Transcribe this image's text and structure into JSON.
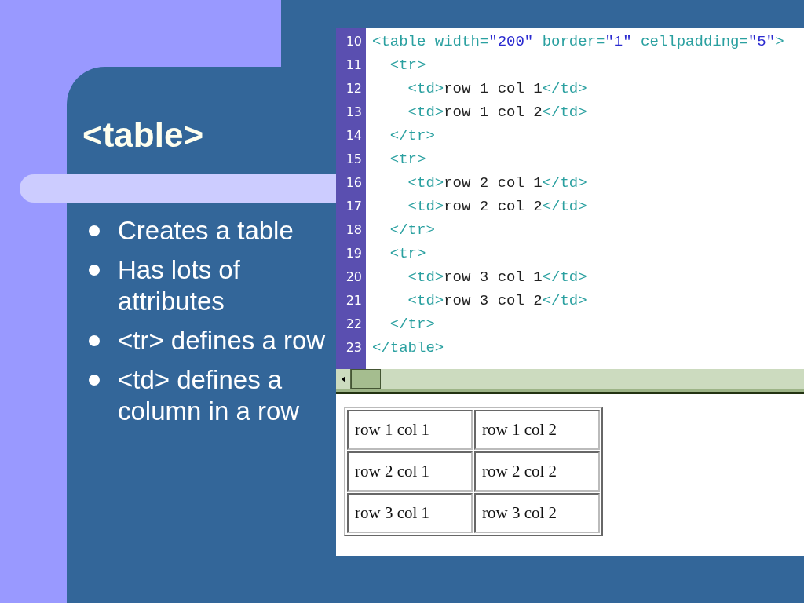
{
  "slide": {
    "title": "<table>",
    "bullets": [
      "Creates a table",
      "Has lots of attributes",
      "<tr> defines a row",
      "<td> defines a column in a row"
    ]
  },
  "editor": {
    "lines": [
      {
        "number": "10",
        "tokens": [
          {
            "kind": "tag",
            "text": "<table width="
          },
          {
            "kind": "value",
            "text": "\"200\""
          },
          {
            "kind": "tag",
            "text": " border="
          },
          {
            "kind": "value",
            "text": "\"1\""
          },
          {
            "kind": "tag",
            "text": " cellpadding="
          },
          {
            "kind": "value",
            "text": "\"5\""
          },
          {
            "kind": "tag",
            "text": ">"
          }
        ]
      },
      {
        "number": "11",
        "tokens": [
          {
            "kind": "tag",
            "text": "  <tr>"
          }
        ]
      },
      {
        "number": "12",
        "tokens": [
          {
            "kind": "tag",
            "text": "    <td>"
          },
          {
            "kind": "text",
            "text": "row 1 col 1"
          },
          {
            "kind": "tag",
            "text": "</td>"
          }
        ]
      },
      {
        "number": "13",
        "tokens": [
          {
            "kind": "tag",
            "text": "    <td>"
          },
          {
            "kind": "text",
            "text": "row 1 col 2"
          },
          {
            "kind": "tag",
            "text": "</td>"
          }
        ]
      },
      {
        "number": "14",
        "tokens": [
          {
            "kind": "tag",
            "text": "  </tr>"
          }
        ]
      },
      {
        "number": "15",
        "tokens": [
          {
            "kind": "tag",
            "text": "  <tr>"
          }
        ]
      },
      {
        "number": "16",
        "tokens": [
          {
            "kind": "tag",
            "text": "    <td>"
          },
          {
            "kind": "text",
            "text": "row 2 col 1"
          },
          {
            "kind": "tag",
            "text": "</td>"
          }
        ]
      },
      {
        "number": "17",
        "tokens": [
          {
            "kind": "tag",
            "text": "    <td>"
          },
          {
            "kind": "text",
            "text": "row 2 col 2"
          },
          {
            "kind": "tag",
            "text": "</td>"
          }
        ]
      },
      {
        "number": "18",
        "tokens": [
          {
            "kind": "tag",
            "text": "  </tr>"
          }
        ]
      },
      {
        "number": "19",
        "tokens": [
          {
            "kind": "tag",
            "text": "  <tr>"
          }
        ]
      },
      {
        "number": "20",
        "tokens": [
          {
            "kind": "tag",
            "text": "    <td>"
          },
          {
            "kind": "text",
            "text": "row 3 col 1"
          },
          {
            "kind": "tag",
            "text": "</td>"
          }
        ]
      },
      {
        "number": "21",
        "tokens": [
          {
            "kind": "tag",
            "text": "    <td>"
          },
          {
            "kind": "text",
            "text": "row 3 col 2"
          },
          {
            "kind": "tag",
            "text": "</td>"
          }
        ]
      },
      {
        "number": "22",
        "tokens": [
          {
            "kind": "tag",
            "text": "  </tr>"
          }
        ]
      },
      {
        "number": "23",
        "tokens": [
          {
            "kind": "tag",
            "text": "</table>"
          }
        ]
      }
    ]
  },
  "preview": {
    "table": [
      [
        "row 1 col 1",
        "row 1 col 2"
      ],
      [
        "row 2 col 1",
        "row 2 col 2"
      ],
      [
        "row 3 col 1",
        "row 3 col 2"
      ]
    ]
  }
}
